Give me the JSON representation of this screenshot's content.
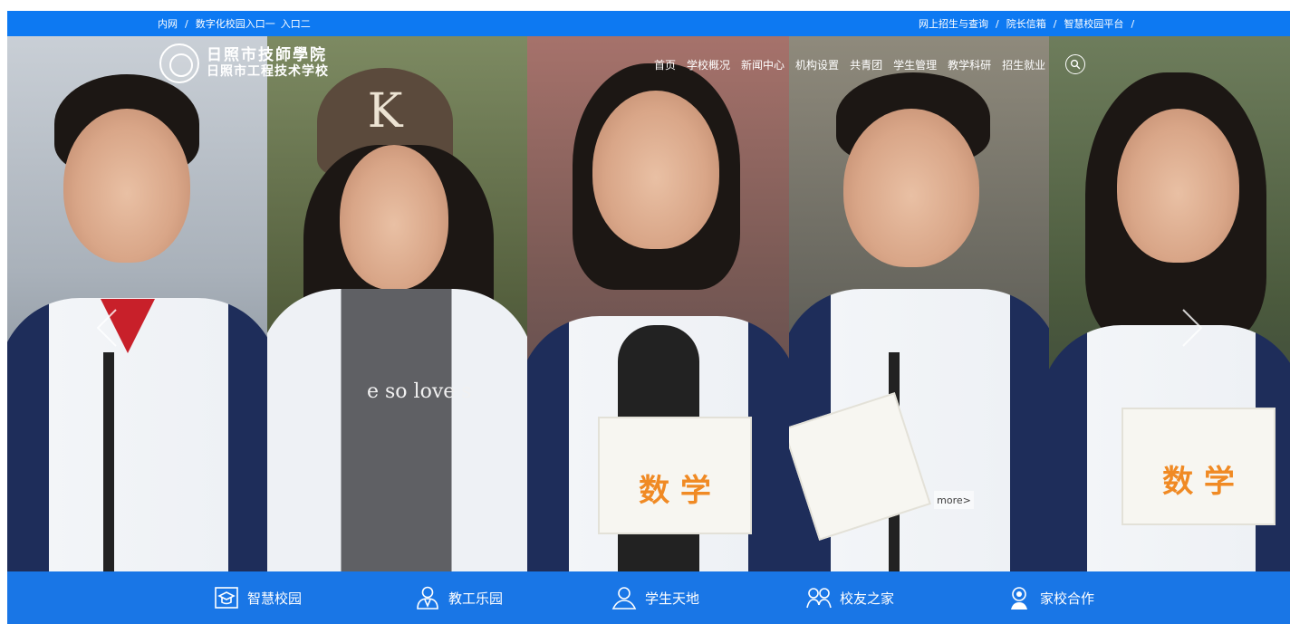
{
  "topbar": {
    "left_links": [
      {
        "label": "内网"
      },
      {
        "label": "数字化校园入口一"
      },
      {
        "label": "入口二"
      }
    ],
    "right_links": [
      {
        "label": "网上招生与查询"
      },
      {
        "label": "院长信箱"
      },
      {
        "label": "智慧校园平台"
      }
    ],
    "separator": "/"
  },
  "logo": {
    "name_main": "日照市技師學院",
    "name_sub": "日照市工程技术学校"
  },
  "nav": {
    "items": [
      {
        "label": "首页"
      },
      {
        "label": "学校概况"
      },
      {
        "label": "新闻中心"
      },
      {
        "label": "机构设置"
      },
      {
        "label": "共青团"
      },
      {
        "label": "学生管理"
      },
      {
        "label": "教学科研"
      },
      {
        "label": "招生就业"
      }
    ],
    "search_icon": "search-icon"
  },
  "hero": {
    "book_title": "数 学",
    "jacket_text": "e so love s",
    "cap_letter": "K",
    "more_label": "more>",
    "prev_icon": "chevron-left-icon",
    "next_icon": "chevron-right-icon"
  },
  "quick_links": [
    {
      "label": "智慧校园",
      "icon": "graduation-cap-icon"
    },
    {
      "label": "教工乐园",
      "icon": "teacher-icon"
    },
    {
      "label": "学生天地",
      "icon": "student-icon"
    },
    {
      "label": "校友之家",
      "icon": "alumni-icon"
    },
    {
      "label": "家校合作",
      "icon": "family-icon"
    }
  ],
  "colors": {
    "topbar_bg": "#0d79f2",
    "bottombar_bg": "#1976e6",
    "text": "#ffffff"
  }
}
